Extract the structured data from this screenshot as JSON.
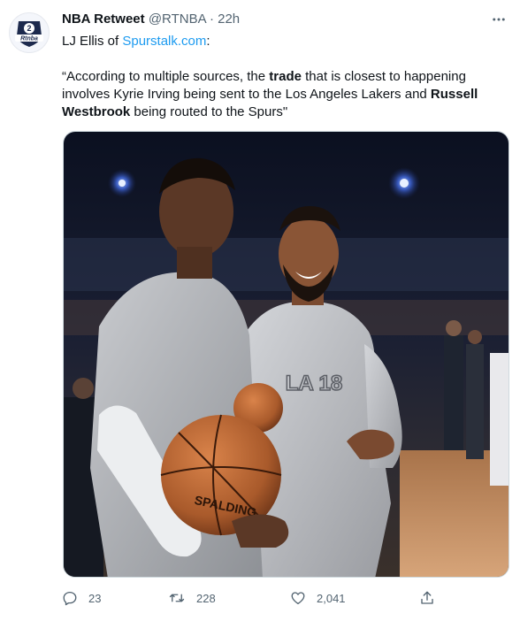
{
  "tweet": {
    "author": {
      "display_name": "NBA Retweet",
      "handle": "@RTNBA",
      "separator": "·",
      "time": "22h",
      "avatar_text": "Rtnba",
      "avatar_number": "2"
    },
    "line1": {
      "prefix": "LJ Ellis of ",
      "link_text": "Spurstalk.com",
      "suffix": ":"
    },
    "quote": {
      "part1": "“According to multiple sources, the ",
      "bold1": "trade",
      "part2": " that is closest to happening involves Kyrie Irving being sent to the Los Angeles Lakers and ",
      "bold2": "Russell Westbrook",
      "part3": " being routed to the Spurs\""
    },
    "media": {
      "jersey_text": "LA 18",
      "ball_text": "SPALDING"
    },
    "actions": {
      "replies": "23",
      "retweets": "228",
      "likes": "2,041"
    }
  },
  "colors": {
    "link": "#1d9bf0",
    "muted": "#536471",
    "text": "#0f1419",
    "avatar_navy": "#1d2a4d"
  },
  "icons": {
    "more": "more-horizontal-icon",
    "reply": "reply-icon",
    "retweet": "retweet-icon",
    "like": "heart-icon",
    "share": "share-icon"
  }
}
